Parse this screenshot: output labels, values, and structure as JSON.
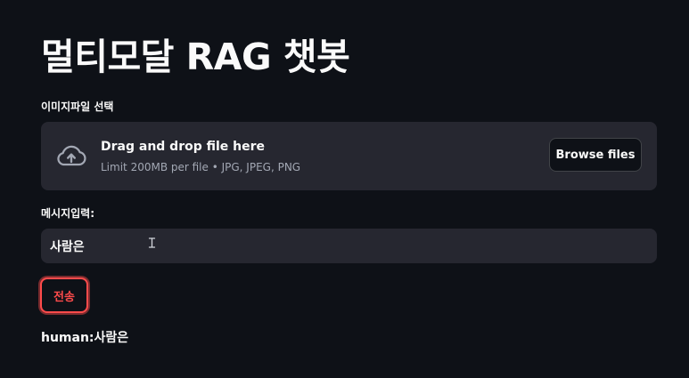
{
  "header": {
    "title": "멀티모달 RAG 챗봇"
  },
  "uploader": {
    "label": "이미지파일 선택",
    "drop_title": "Drag and drop file here",
    "limit_text": "Limit 200MB per file • JPG, JPEG, PNG",
    "browse_label": "Browse files",
    "icon": "cloud-upload-icon"
  },
  "message": {
    "label": "메시지입력:",
    "value": "사람은"
  },
  "send": {
    "label": "전송",
    "accent_color": "#ff4b4b"
  },
  "chat": {
    "line": "human:사람은"
  },
  "colors": {
    "background": "#0e1117",
    "widget": "#262730",
    "text": "#fafafa",
    "muted": "#a3a8b4"
  }
}
